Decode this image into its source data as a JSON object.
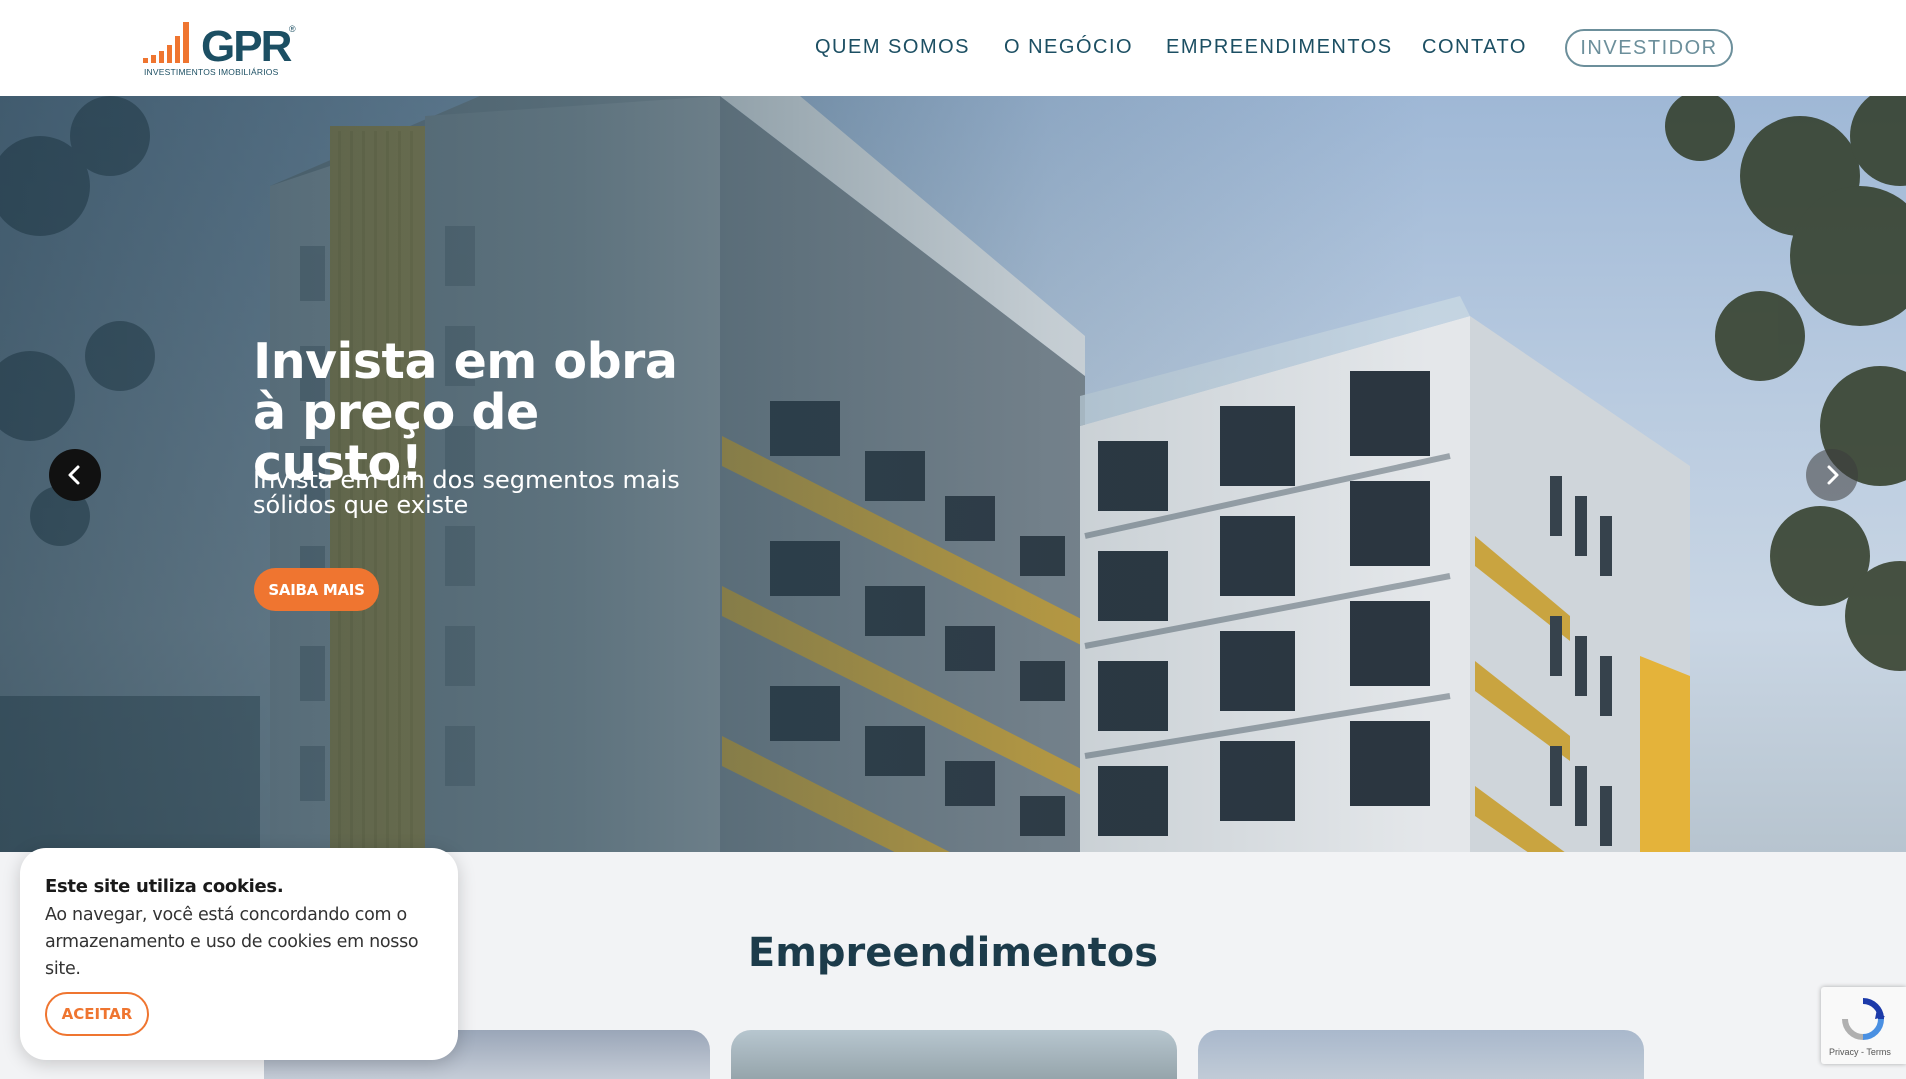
{
  "brand": {
    "logo_text": "GPR",
    "logo_reg": "®",
    "logo_sub": "INVESTIMENTOS IMOBILIÁRIOS",
    "colors": {
      "primary": "#1c4f63",
      "accent": "#ef7530",
      "muted": "#6c8f9b"
    }
  },
  "nav": {
    "items": [
      {
        "label": "QUEM SOMOS"
      },
      {
        "label": "O NEGÓCIO"
      },
      {
        "label": "EMPREENDIMENTOS"
      },
      {
        "label": "CONTATO"
      }
    ],
    "investor_label": "INVESTIDOR"
  },
  "hero": {
    "title": "Invista em obra à preço de custo!",
    "subtitle": "Invista em um dos segmentos mais sólidos que existe",
    "cta_label": "SAIBA MAIS",
    "prev_icon": "chevron-left-icon",
    "next_icon": "chevron-right-icon"
  },
  "section": {
    "title": "Empreendimentos"
  },
  "cookie": {
    "title": "Este site utiliza cookies.",
    "text": "Ao navegar, você está concordando com o armazenamento e uso de cookies em nosso site.",
    "accept_label": "ACEITAR"
  },
  "recaptcha": {
    "links": "Privacy - Terms"
  }
}
